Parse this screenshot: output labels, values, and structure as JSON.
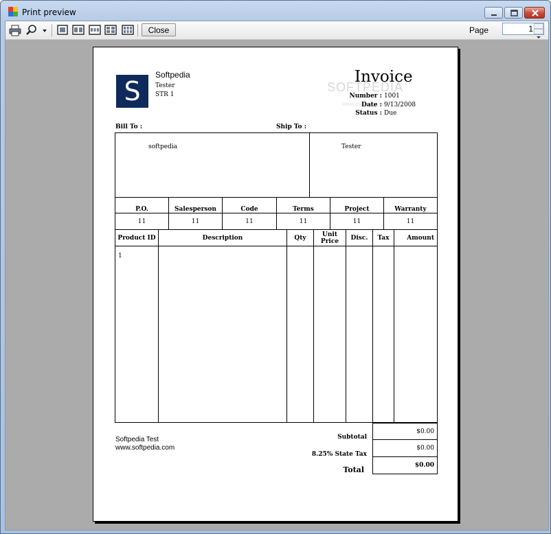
{
  "window": {
    "title": "Print preview",
    "close_button_label": "Close",
    "page_label": "Page",
    "page_value": "1"
  },
  "toolbar": {
    "icons": [
      "printer-icon",
      "zoom-icon",
      "one-page-icon",
      "two-pages-icon",
      "three-pages-icon",
      "four-pages-icon",
      "six-pages-icon"
    ]
  },
  "invoice": {
    "company_name": "Softpedia",
    "company_line1": "Tester",
    "company_line2": "STR 1",
    "logo_letter": "S",
    "title": "Invoice",
    "number_label": "Number :",
    "number_value": "1001",
    "date_label": "Date :",
    "date_value": "9/13/2008",
    "status_label": "Status :",
    "status_value": "Due",
    "watermark": "SOFTPEDIA",
    "watermark_sub": "www.softpedia.com",
    "bill_to_label": "Bill To :",
    "ship_to_label": "Ship To :",
    "bill_to_value": "softpedia",
    "ship_to_value": "Tester",
    "info_headers": [
      "P.O.",
      "Salesperson",
      "Code",
      "Terms",
      "Project",
      "Warranty"
    ],
    "info_values": [
      "11",
      "11",
      "11",
      "11",
      "11",
      "11"
    ],
    "item_headers": [
      "Product ID",
      "Description",
      "Qty",
      "Unit Price",
      "Disc.",
      "Tax",
      "Amount"
    ],
    "item_rows": [
      [
        "1",
        "",
        "",
        "",
        "",
        "",
        ""
      ]
    ],
    "footer_line1": "Softpedia Test",
    "footer_line2": "www.softpedia.com",
    "subtotal_label": "Subtotal",
    "subtotal_value": "$0.00",
    "tax_label": "8.25% State Tax",
    "tax_value": "$0.00",
    "total_label": "Total",
    "total_value": "$0.00"
  }
}
